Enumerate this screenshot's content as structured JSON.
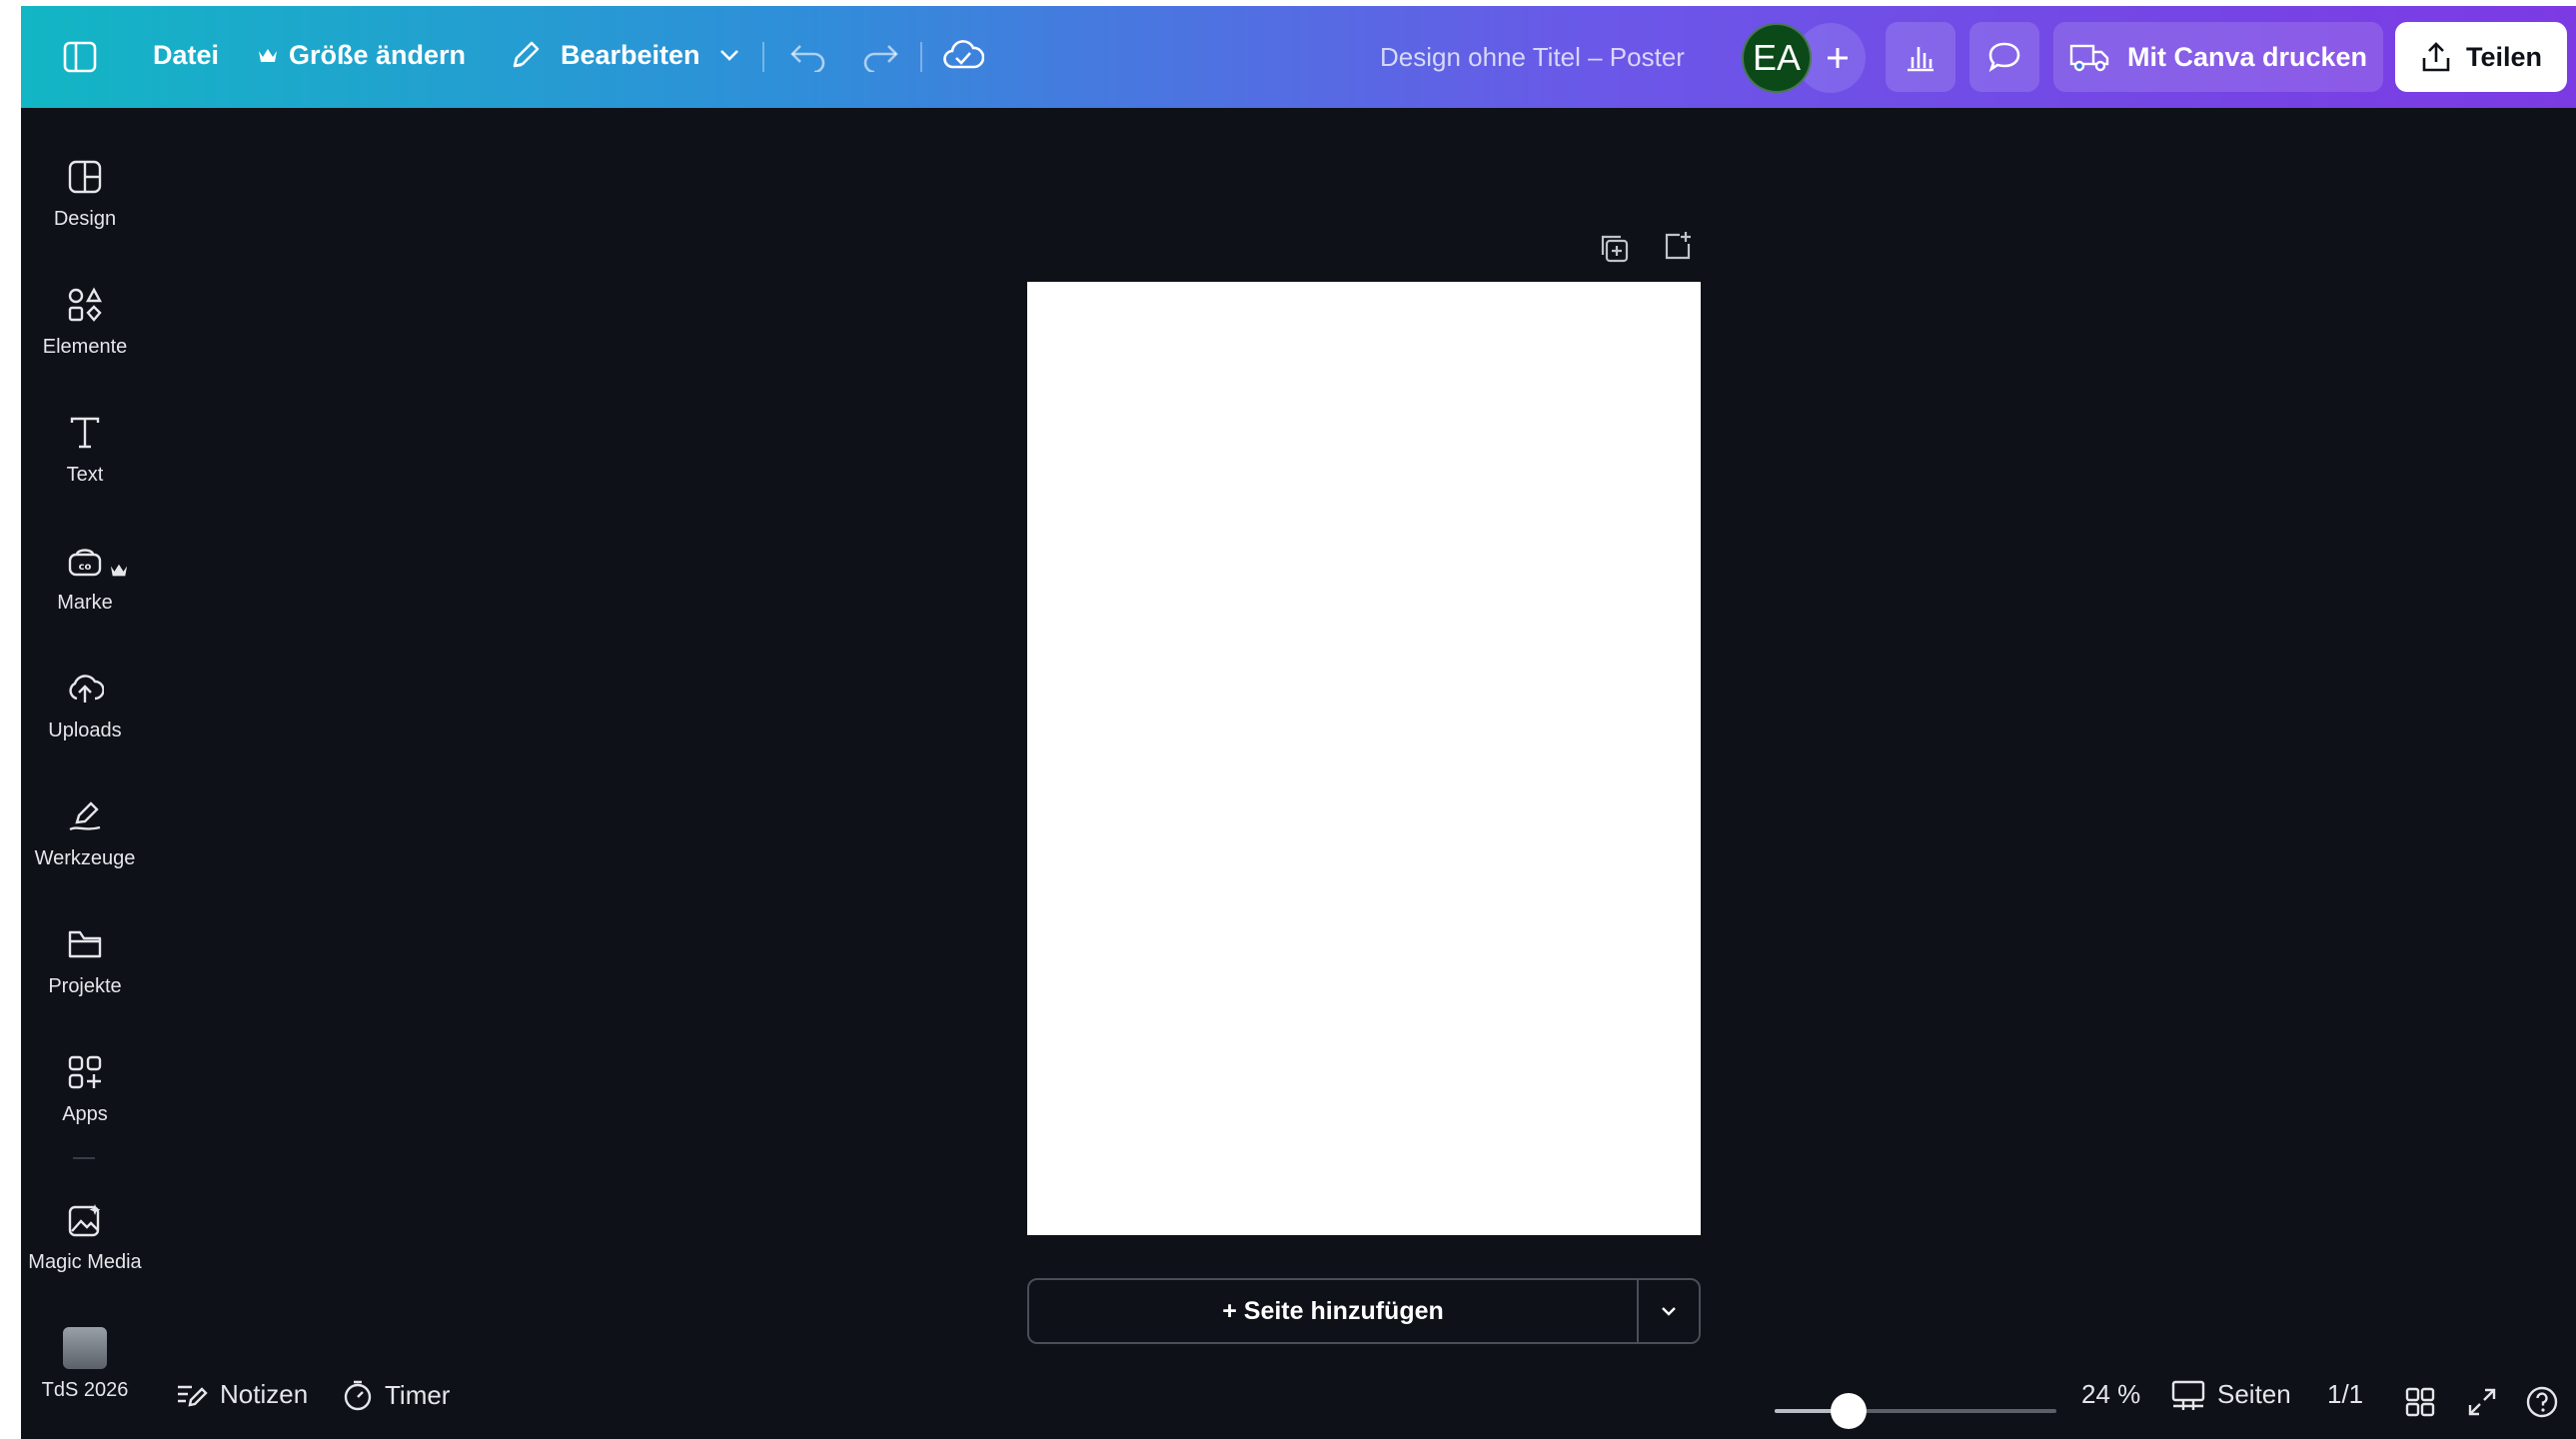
{
  "topbar": {
    "file_label": "Datei",
    "resize_label": "Größe ändern",
    "edit_label": "Bearbeiten",
    "document_title": "Design ohne Titel – Poster",
    "avatar_initials": "EA",
    "print_label": "Mit Canva drucken",
    "share_label": "Teilen"
  },
  "sidebar": {
    "items": [
      {
        "label": "Design",
        "icon": "design-icon"
      },
      {
        "label": "Elemente",
        "icon": "elements-icon"
      },
      {
        "label": "Text",
        "icon": "text-icon"
      },
      {
        "label": "Marke",
        "icon": "brand-icon",
        "premium": true
      },
      {
        "label": "Uploads",
        "icon": "upload-cloud-icon"
      },
      {
        "label": "Werkzeuge",
        "icon": "draw-tools-icon"
      },
      {
        "label": "Projekte",
        "icon": "folder-icon"
      },
      {
        "label": "Apps",
        "icon": "apps-icon"
      },
      {
        "label": "Magic Media",
        "icon": "magic-media-icon"
      },
      {
        "label": "TdS 2026",
        "icon": "thumbnail"
      }
    ]
  },
  "canvas": {
    "add_page_label": "+ Seite hinzufügen"
  },
  "bottombar": {
    "notes_label": "Notizen",
    "timer_label": "Timer",
    "zoom_percent": 24,
    "zoom_label": "24 %",
    "pages_label": "Seiten",
    "page_counter": "1/1"
  },
  "colors": {
    "gradient_start": "#12b6c4",
    "gradient_end": "#7c3ae3",
    "workspace_bg": "#0e1117",
    "avatar_bg": "#0b4a18"
  }
}
